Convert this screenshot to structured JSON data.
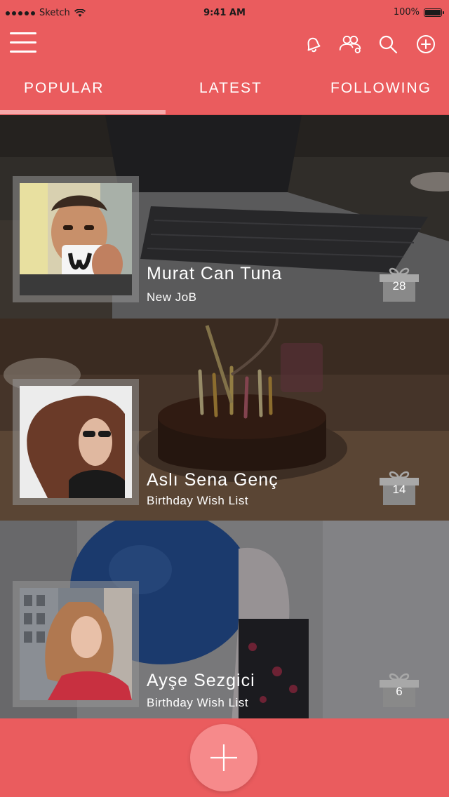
{
  "status_bar": {
    "carrier": "Sketch",
    "time": "9:41 AM",
    "battery": "100%",
    "battery_level": 1.0
  },
  "nav": {
    "icons": [
      "menu-icon",
      "bell-icon",
      "people-icon",
      "search-icon",
      "add-circle-icon"
    ]
  },
  "tabs": [
    {
      "label": "POPULAR",
      "active": true
    },
    {
      "label": "LATEST",
      "active": false
    },
    {
      "label": "FOLLOWING",
      "active": false
    }
  ],
  "feed": [
    {
      "name": "Murat Can Tuna",
      "subtitle": "New JoB",
      "gift_count": "28",
      "background": "laptop-on-desk"
    },
    {
      "name": "Aslı Sena Genç",
      "subtitle": "Birthday Wish List",
      "gift_count": "14",
      "background": "birthday-cake"
    },
    {
      "name": "Ayşe Sezgici",
      "subtitle": "Birthday Wish List",
      "gift_count": "6",
      "background": "blue-balloon"
    }
  ],
  "colors": {
    "accent": "#ea5c5e",
    "tab_indicator": "#f7a9aa",
    "fab": "#f68a8b"
  }
}
